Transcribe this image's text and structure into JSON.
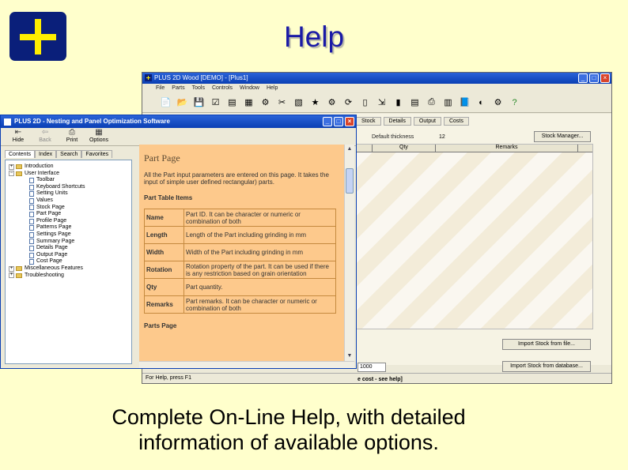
{
  "slide": {
    "title": "Help",
    "caption_line1": "Complete On-Line Help, with detailed",
    "caption_line2": "information of available options."
  },
  "back_window": {
    "title": "PLUS 2D Wood [DEMO] - [Plus1]",
    "menu": [
      "File",
      "Parts",
      "Tools",
      "Controls",
      "Window",
      "Help"
    ],
    "tabs": [
      "Stock",
      "Details",
      "Output",
      "Costs"
    ],
    "field_label": "Default thickness",
    "field_value": "12",
    "grid_headers": [
      "",
      "Qty",
      "Remarks"
    ],
    "buttons": {
      "stock_manager": "Stock Manager...",
      "import_stock": "Import Stock from file...",
      "import_stock_db": "Import Stock from database..."
    },
    "input_value": "1000",
    "note": "e cost - see help]",
    "status": "For Help, press F1"
  },
  "help_window": {
    "title": "PLUS 2D - Nesting and Panel Optimization Software",
    "toolbar": [
      {
        "label": "Hide",
        "icon": "hide-icon",
        "disabled": false
      },
      {
        "label": "Back",
        "icon": "back-arrow-icon",
        "disabled": true
      },
      {
        "label": "Print",
        "icon": "printer-icon",
        "disabled": false
      },
      {
        "label": "Options",
        "icon": "options-icon",
        "disabled": false
      }
    ],
    "tabs": [
      "Contents",
      "Index",
      "Search",
      "Favorites"
    ],
    "tree": [
      {
        "label": "Introduction",
        "type": "folder",
        "indent": 0
      },
      {
        "label": "User Interface",
        "type": "folder",
        "indent": 0,
        "expanded": true
      },
      {
        "label": "Toolbar",
        "type": "doc",
        "indent": 1
      },
      {
        "label": "Keyboard Shortcuts",
        "type": "doc",
        "indent": 1
      },
      {
        "label": "Setting Units",
        "type": "doc",
        "indent": 1
      },
      {
        "label": "Values",
        "type": "doc",
        "indent": 1
      },
      {
        "label": "Stock Page",
        "type": "doc",
        "indent": 1
      },
      {
        "label": "Part Page",
        "type": "doc",
        "indent": 1
      },
      {
        "label": "Profile Page",
        "type": "doc",
        "indent": 1
      },
      {
        "label": "Patterns Page",
        "type": "doc",
        "indent": 1
      },
      {
        "label": "Settings Page",
        "type": "doc",
        "indent": 1
      },
      {
        "label": "Summary Page",
        "type": "doc",
        "indent": 1
      },
      {
        "label": "Details Page",
        "type": "doc",
        "indent": 1
      },
      {
        "label": "Output Page",
        "type": "doc",
        "indent": 1
      },
      {
        "label": "Cost Page",
        "type": "doc",
        "indent": 1
      },
      {
        "label": "Miscellaneous Features",
        "type": "folder",
        "indent": 0
      },
      {
        "label": "Troubleshooting",
        "type": "folder",
        "indent": 0
      }
    ],
    "content": {
      "heading": "Part Page",
      "intro": "All the Part input parameters are entered on this page. It takes the input of simple user defined rectangular) parts.",
      "table_heading": "Part Table Items",
      "rows": [
        {
          "name": "Name",
          "desc": "Part ID. It can be character or numeric or combination of both"
        },
        {
          "name": "Length",
          "desc": "Length of the Part including grinding in mm"
        },
        {
          "name": "Width",
          "desc": "Width of the Part including grinding in mm"
        },
        {
          "name": "Rotation",
          "desc": "Rotation property of the part. It can be used if there is any restriction based on grain orientation"
        },
        {
          "name": "Qty",
          "desc": "Part quantity."
        },
        {
          "name": "Remarks",
          "desc": "Part remarks. It can be character or numeric or combination of both"
        }
      ],
      "footer_heading": "Parts Page"
    }
  },
  "colors": {
    "background": "#ffffcc",
    "title_blue": "#1a1aa6",
    "logo_blue": "#0a1f7a",
    "logo_yellow": "#ffee00",
    "help_content_bg": "#fdc98c"
  }
}
